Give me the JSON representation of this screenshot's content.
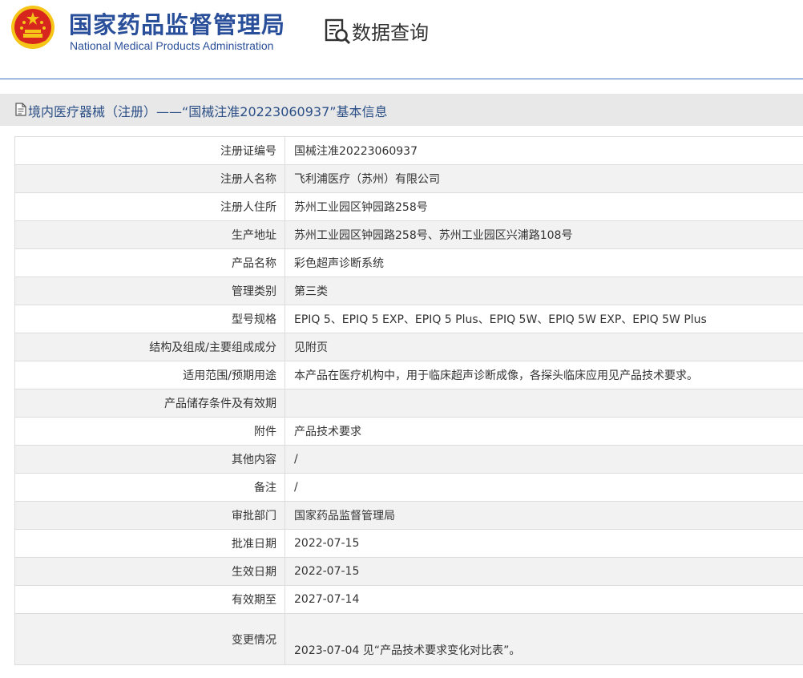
{
  "header": {
    "org_name_cn": "国家药品监督管理局",
    "org_name_en": "National Medical Products Administration",
    "query_label": "数据查询"
  },
  "title_bar": {
    "title": "境内医疗器械（注册）——“国械注准20223060937”基本信息"
  },
  "rows": [
    {
      "label": "注册证编号",
      "value": "国械注准20223060937"
    },
    {
      "label": "注册人名称",
      "value": "飞利浦医疗（苏州）有限公司"
    },
    {
      "label": "注册人住所",
      "value": "苏州工业园区钟园路258号"
    },
    {
      "label": "生产地址",
      "value": "苏州工业园区钟园路258号、苏州工业园区兴浦路108号"
    },
    {
      "label": "产品名称",
      "value": "彩色超声诊断系统"
    },
    {
      "label": "管理类别",
      "value": "第三类"
    },
    {
      "label": "型号规格",
      "value": "EPIQ 5、EPIQ 5 EXP、EPIQ 5 Plus、EPIQ 5W、EPIQ 5W EXP、EPIQ 5W Plus"
    },
    {
      "label": "结构及组成/主要组成成分",
      "value": "见附页"
    },
    {
      "label": "适用范围/预期用途",
      "value": "本产品在医疗机构中，用于临床超声诊断成像，各探头临床应用见产品技术要求。"
    },
    {
      "label": "产品储存条件及有效期",
      "value": ""
    },
    {
      "label": "附件",
      "value": "产品技术要求"
    },
    {
      "label": "其他内容",
      "value": "/"
    },
    {
      "label": "备注",
      "value": "/"
    },
    {
      "label": "审批部门",
      "value": "国家药品监督管理局"
    },
    {
      "label": "批准日期",
      "value": "2022-07-15"
    },
    {
      "label": "生效日期",
      "value": "2022-07-15"
    },
    {
      "label": "有效期至",
      "value": "2027-07-14"
    },
    {
      "label": "变更情况",
      "value": "2023-07-04 见“产品技术要求变化对比表”。"
    }
  ],
  "colors": {
    "brand_blue": "#2a4f9a",
    "header_rule": "#3a6fc4",
    "title_bar_bg": "#e8e8e8",
    "row_stripe": "#f2f2f2",
    "emblem_red": "#d7261e",
    "emblem_gold": "#f5c518"
  },
  "icons": {
    "emblem": "national-emblem-icon",
    "query": "document-search-icon",
    "title": "document-icon"
  }
}
